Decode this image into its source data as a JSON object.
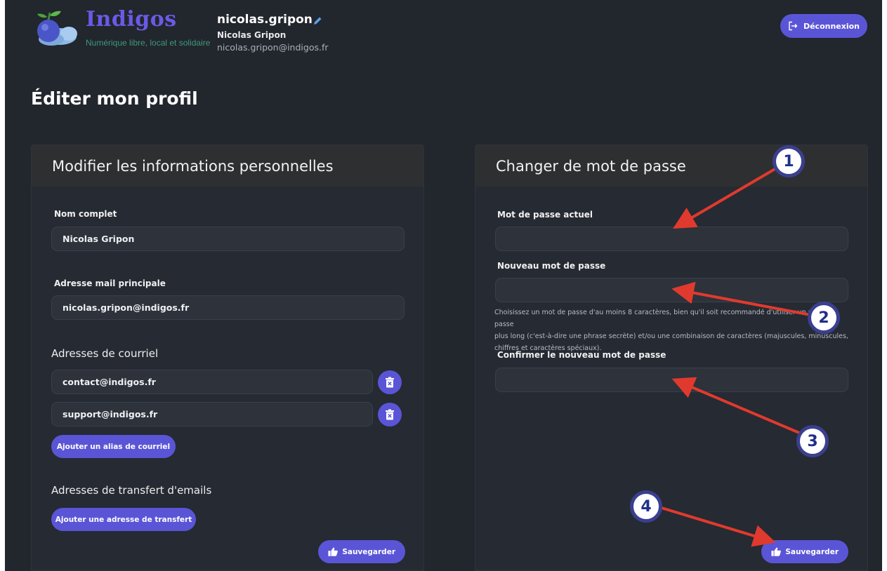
{
  "brand": {
    "name": "Indigos",
    "tagline": "Numérique libre, local et solidaire"
  },
  "user": {
    "handle": "nicolas.gripon",
    "full_name": "Nicolas Gripon",
    "email": "nicolas.gripon@indigos.fr"
  },
  "header": {
    "logout_label": "Déconnexion"
  },
  "page": {
    "title": "Éditer mon profil"
  },
  "personal": {
    "title": "Modifier les informations personnelles",
    "full_name_label": "Nom complet",
    "full_name_value": "Nicolas Gripon",
    "main_email_label": "Adresse mail principale",
    "main_email_value": "nicolas.gripon@indigos.fr",
    "aliases_title": "Adresses de courriel",
    "aliases": [
      "contact@indigos.fr",
      "support@indigos.fr"
    ],
    "add_alias_label": "Ajouter un alias de courriel",
    "forwarding_title": "Adresses de transfert d'emails",
    "add_forwarding_label": "Ajouter une adresse de transfert",
    "save_label": "Sauvegarder"
  },
  "password": {
    "title": "Changer de mot de passe",
    "current_label": "Mot de passe actuel",
    "current_value": "",
    "new_label": "Nouveau mot de passe",
    "new_value": "",
    "help_line1": "Choisissez un mot de passe d'au moins 8 caractères, bien qu'il soit recommandé d'utiliser un mot de passe",
    "help_line2": "plus long (c'est-à-dire une phrase secrète) et/ou une combinaison de caractères (majuscules, minuscules,",
    "help_line3": "chiffres et caractères spéciaux).",
    "confirm_label": "Confirmer le nouveau mot de passe",
    "confirm_value": "",
    "save_label": "Sauvegarder"
  },
  "annotations": {
    "badge1": "1",
    "badge2": "2",
    "badge3": "3",
    "badge4": "4"
  },
  "colors": {
    "background": "#22262d",
    "accent": "#5a55d6",
    "brand": "#6a5ae6",
    "annotation_arrow": "#e03a2e",
    "badge_border": "#3a3f8f"
  },
  "icons": {
    "logo": "plum-cloud-logo",
    "edit": "pencil-icon",
    "logout": "logout-icon",
    "delete": "trash-x-icon",
    "save": "thumbs-up-icon"
  }
}
